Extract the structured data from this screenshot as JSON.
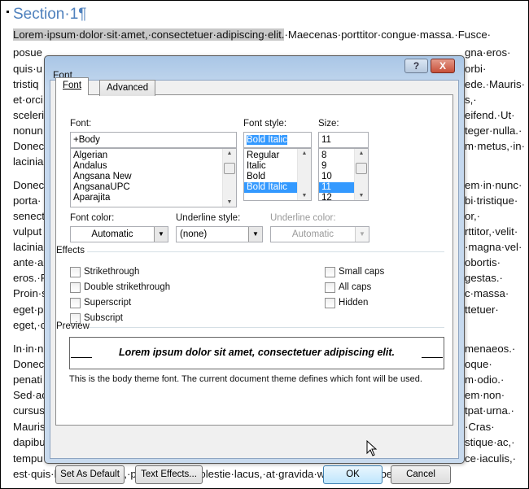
{
  "document": {
    "heading": "Section·1¶",
    "first_line_selected": "Lorem·ipsum·dolor·sit·amet,·consectetuer·adipiscing·elit.",
    "first_line_rest": "·Maecenas·porttitor·congue·massa.·Fusce·",
    "lines": [
      {
        "l": "posue",
        "r": "gna·eros·"
      },
      {
        "l": "quis·u",
        "r": "orbi·"
      },
      {
        "l": "tristiq",
        "r": "ede.·Mauris·"
      },
      {
        "l": "et·orci",
        "r": "s,·"
      },
      {
        "l": "sceleri",
        "r": "eifend.·Ut·"
      },
      {
        "l": "nonun",
        "r": "teger·nulla.·"
      },
      {
        "l": "Donec",
        "r": "m·metus,·in·"
      },
      {
        "l": "lacinia",
        "r": ""
      },
      {
        "l": "Donec",
        "r": "em·in·nunc·"
      },
      {
        "l": "porta·",
        "r": "bi·tristique·"
      },
      {
        "l": "senect",
        "r": "or,·"
      },
      {
        "l": "vulput",
        "r": "rttitor,·velit·"
      },
      {
        "l": "lacinia",
        "r": "·magna·vel·"
      },
      {
        "l": "ante·a",
        "r": "obortis·"
      },
      {
        "l": "eros.·P",
        "r": "gestas.·"
      },
      {
        "l": "Proin·s",
        "r": "c·massa·"
      },
      {
        "l": "eget·p",
        "r": "ttetuer·"
      },
      {
        "l": "eget,·c",
        "r": ""
      },
      {
        "l": "In·in·n",
        "r": "menaeos.·"
      },
      {
        "l": "Donec",
        "r": "oque·"
      },
      {
        "l": "penati",
        "r": "m·odio.·"
      },
      {
        "l": "Sed·ac",
        "r": "em·non·"
      },
      {
        "l": "cursus",
        "r": "tpat·urna.·"
      },
      {
        "l": "Mauris",
        "r": "·Cras·"
      },
      {
        "l": "dapibu",
        "r": "stique·ac,·"
      },
      {
        "l": "tempu",
        "r": "ce·iaculis,·"
      }
    ],
    "last_line": "est·quis·lacinia·pretium,·pede·metus·molestie·lacus,·at·gravida·wisi·ante·at·libero.¶"
  },
  "dialog": {
    "title": "Font",
    "help": "?",
    "close": "X",
    "tabs": [
      "Font",
      "Advanced"
    ],
    "font_label": "Font:",
    "font_value": "+Body",
    "font_list": [
      "Algerian",
      "Andalus",
      "Angsana New",
      "AngsanaUPC",
      "Aparajita"
    ],
    "style_label": "Font style:",
    "style_value": "Bold Italic",
    "style_list": [
      "Regular",
      "Italic",
      "Bold",
      "Bold Italic"
    ],
    "style_selected": "Bold Italic",
    "size_label": "Size:",
    "size_value": "11",
    "size_list": [
      "8",
      "9",
      "10",
      "11",
      "12"
    ],
    "size_selected": "11",
    "font_color_label": "Font color:",
    "font_color_value": "Automatic",
    "underline_style_label": "Underline style:",
    "underline_style_value": "(none)",
    "underline_color_label": "Underline color:",
    "underline_color_value": "Automatic",
    "effects_label": "Effects",
    "effects_left": [
      "Strikethrough",
      "Double strikethrough",
      "Superscript",
      "Subscript"
    ],
    "effects_right": [
      "Small caps",
      "All caps",
      "Hidden"
    ],
    "preview_label": "Preview",
    "preview_text": "Lorem ipsum dolor sit amet, consectetuer adipiscing elit.",
    "preview_note": "This is the body theme font. The current document theme defines which font will be used.",
    "buttons": {
      "set_default": "Set As Default",
      "text_effects": "Text Effects...",
      "ok": "OK",
      "cancel": "Cancel"
    }
  }
}
